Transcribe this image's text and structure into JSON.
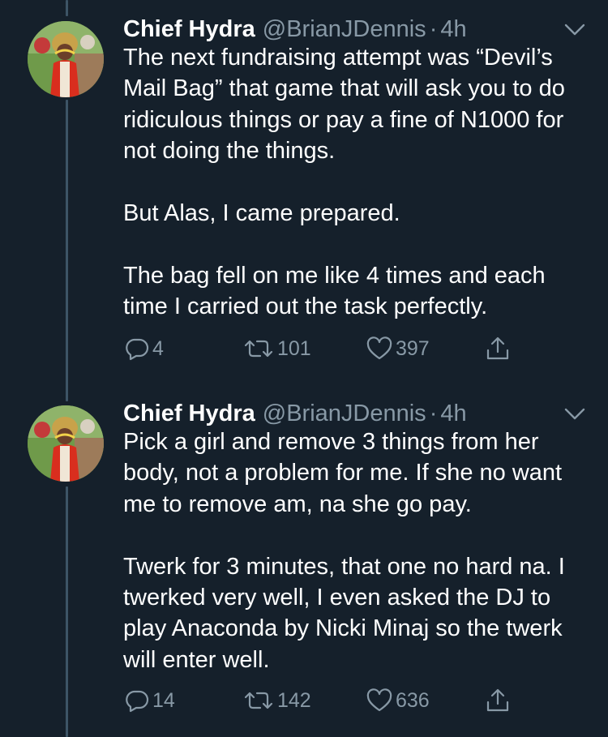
{
  "tweets": [
    {
      "name": "Chief Hydra",
      "handle": "@BrianJDennis",
      "separator": "·",
      "time": "4h",
      "paragraphs": [
        "The next fundraising attempt was “Devil’s Mail Bag” that game that will ask you to do ridiculous things or pay a fine of N1000  for not doing the things.",
        "But Alas, I came prepared.",
        "The bag fell on me like 4 times and each time I carried out the task perfectly."
      ],
      "replies": "4",
      "retweets": "101",
      "likes": "397"
    },
    {
      "name": "Chief Hydra",
      "handle": "@BrianJDennis",
      "separator": "·",
      "time": "4h",
      "paragraphs": [
        "Pick a girl and remove 3 things from her body, not a problem for me. If she no want me to remove am, na she go pay.",
        "Twerk for 3 minutes, that one no hard na. I twerked very well, I even asked the DJ to play Anaconda by Nicki Minaj so the twerk will enter well."
      ],
      "replies": "14",
      "retweets": "142",
      "likes": "636"
    }
  ],
  "icons": {
    "reply": "reply-icon",
    "retweet": "retweet-icon",
    "like": "heart-icon",
    "share": "share-icon",
    "caret": "chevron-down-icon"
  },
  "colors": {
    "background": "#15202b",
    "secondary_text": "#8899a6",
    "thread_line": "#3d5466"
  }
}
